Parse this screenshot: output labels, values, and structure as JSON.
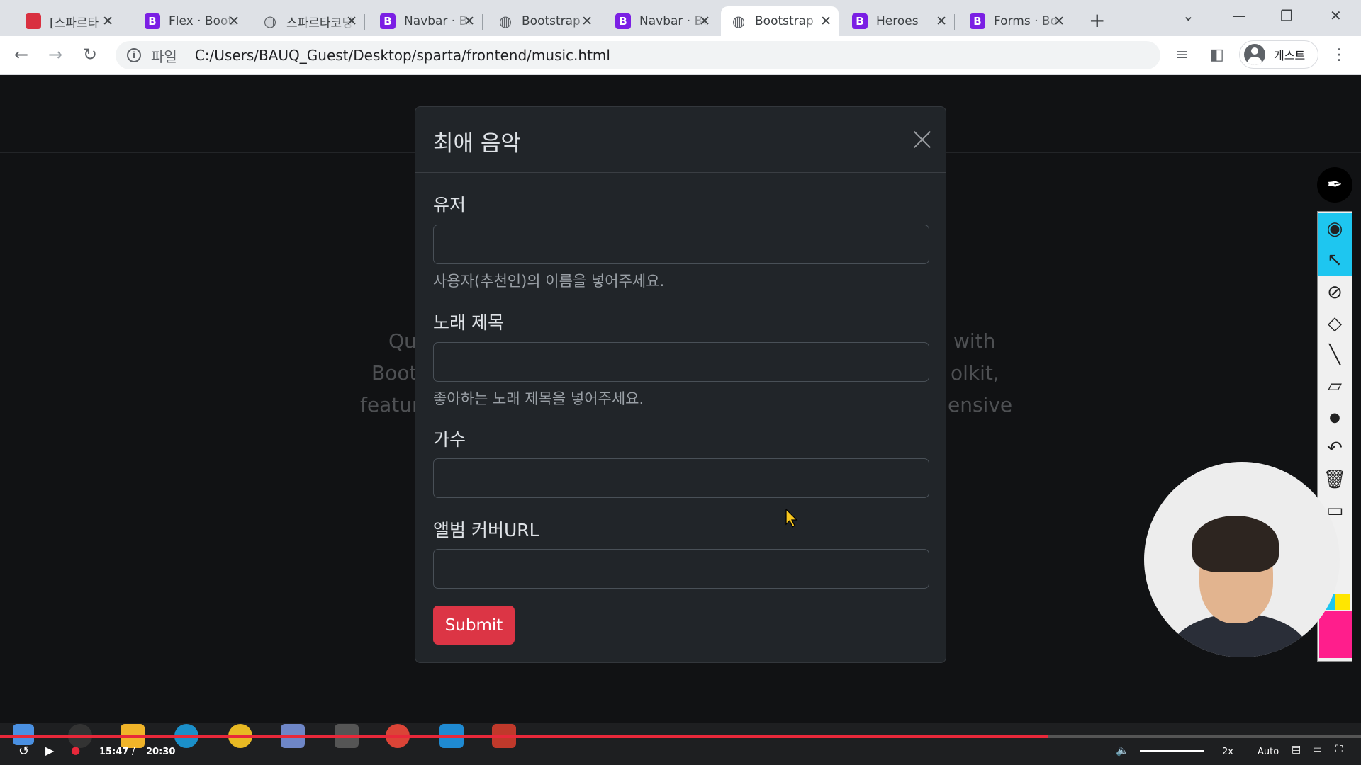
{
  "browser": {
    "tabs": [
      {
        "title": "[스파르타",
        "favicon": "red-book-icon"
      },
      {
        "title": "Flex · Bootstrap",
        "favicon": "bootstrap-icon"
      },
      {
        "title": "스파르타코딩",
        "favicon": "globe-icon"
      },
      {
        "title": "Navbar · Bootstrap",
        "favicon": "bootstrap-icon"
      },
      {
        "title": "Bootstrap",
        "favicon": "globe-icon"
      },
      {
        "title": "Navbar · Bootstrap",
        "favicon": "bootstrap-icon"
      },
      {
        "title": "Bootstrap",
        "favicon": "globe-icon",
        "active": true
      },
      {
        "title": "Heroes",
        "favicon": "bootstrap-icon"
      },
      {
        "title": "Forms · Bootstrap",
        "favicon": "bootstrap-icon"
      }
    ],
    "address": {
      "scheme_label": "파일",
      "url": "C:/Users/BAUQ_Guest/Desktop/sparta/frontend/music.html"
    },
    "profile_label": "게스트"
  },
  "page": {
    "background_fragments": {
      "left": [
        "Qu",
        "Boot",
        "featur"
      ],
      "right": [
        "with",
        "olkit,",
        "ensive"
      ]
    }
  },
  "modal": {
    "title": "최애 음악",
    "fields": [
      {
        "label": "유저",
        "value": "",
        "help": "사용자(추천인)의 이름을 넣어주세요."
      },
      {
        "label": "노래 제목",
        "value": "",
        "help": "좋아하는 노래 제목을 넣어주세요."
      },
      {
        "label": "가수",
        "value": "",
        "help": ""
      },
      {
        "label": "앨범 커버URL",
        "value": "",
        "help": ""
      }
    ],
    "submit_label": "Submit"
  },
  "player": {
    "current_time": "15:47",
    "separator": "/",
    "total_time": "20:30",
    "speed": "2x",
    "quality": "Auto",
    "progress_fraction": 0.77
  },
  "colors": {
    "submit_red": "#dc3545",
    "bootstrap_purple": "#7b1fe4",
    "progress_red": "#e8283a"
  }
}
